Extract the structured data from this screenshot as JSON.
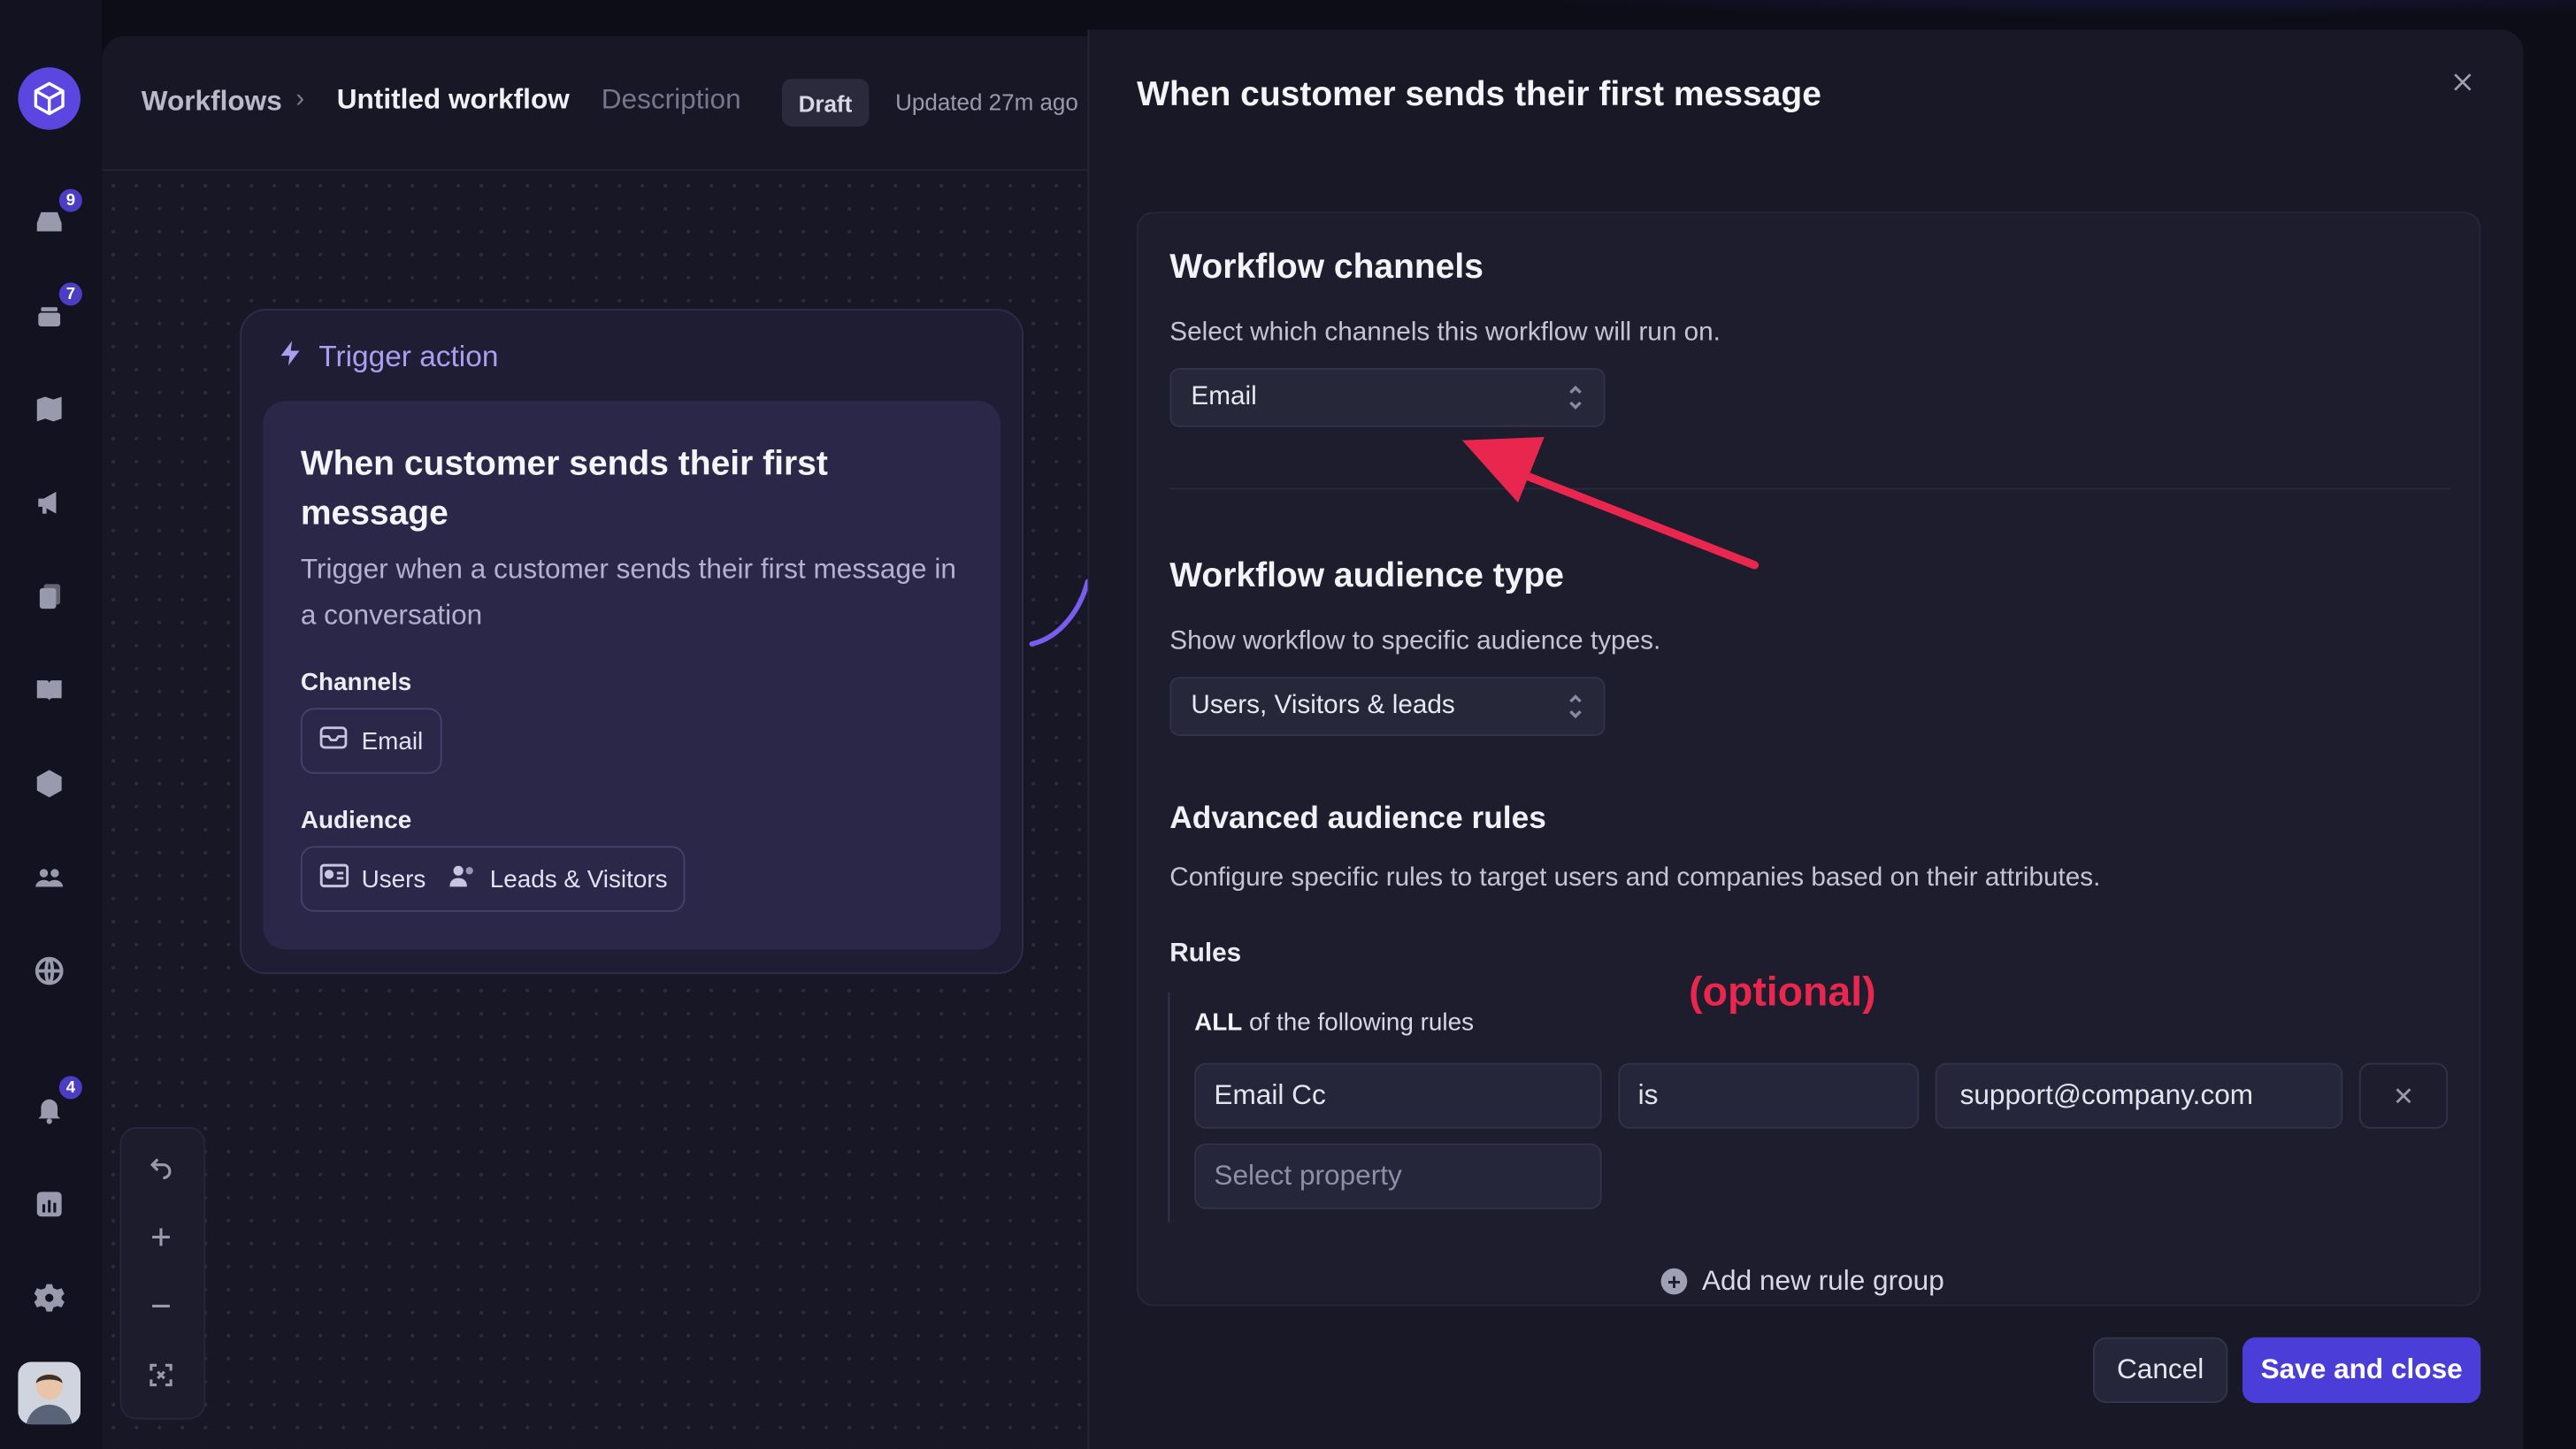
{
  "breadcrumb": {
    "root": "Workflows",
    "separator": "›",
    "title": "Untitled workflow",
    "description_link": "Description",
    "status_badge": "Draft",
    "updated": "Updated 27m ago"
  },
  "nav": {
    "badges": {
      "inbox": "9",
      "tickets": "7",
      "notifications": "4"
    },
    "icons": [
      "logo-icon",
      "inbox-icon",
      "tickets-icon",
      "map-icon",
      "megaphone-icon",
      "documents-icon",
      "book-icon",
      "bot-icon",
      "contacts-icon",
      "globe-icon",
      "bell-icon",
      "reports-icon",
      "settings-icon"
    ]
  },
  "trigger_card": {
    "header": "Trigger action",
    "title": "When customer sends their first message",
    "description": "Trigger when a customer sends their first message in a conversation",
    "channels_label": "Channels",
    "channel": "Email",
    "audience_label": "Audience",
    "audience": [
      "Users",
      "Leads & Visitors"
    ]
  },
  "panel": {
    "title": "When customer sends their first message",
    "channels": {
      "heading": "Workflow channels",
      "help": "Select which channels this workflow will run on.",
      "selected": "Email"
    },
    "audience_type": {
      "heading": "Workflow audience type",
      "help": "Show workflow to specific audience types.",
      "selected": "Users, Visitors & leads"
    },
    "advanced": {
      "heading": "Advanced audience rules",
      "help": "Configure specific rules to target users and companies based on their attributes.",
      "rules_label": "Rules",
      "annotation": "(optional)",
      "match_strong": "ALL",
      "match_rest": " of the following rules",
      "rule": {
        "property": "Email Cc",
        "operator": "is",
        "value": "support@company.com"
      },
      "placeholder": "Select property",
      "add_group": "Add new rule group"
    },
    "cancel": "Cancel",
    "save": "Save and close"
  },
  "colors": {
    "accent": "#4b3ed8",
    "annotation": "#e8264e",
    "trigger": "#a99ef0"
  }
}
